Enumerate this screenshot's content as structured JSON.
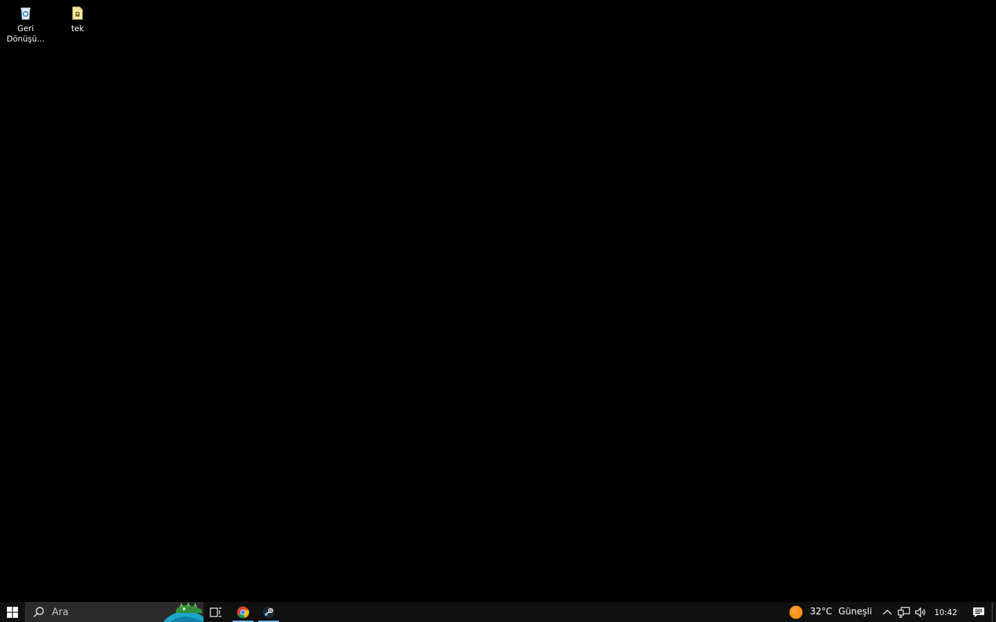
{
  "desktop": {
    "icons": [
      {
        "label": "Geri Dönüşü...",
        "icon": "recycle-bin-icon"
      },
      {
        "label": "tek",
        "icon": "file-icon"
      }
    ]
  },
  "taskbar": {
    "start_icon": "windows-logo-icon",
    "search": {
      "placeholder": "Ara",
      "value": ""
    },
    "task_view_icon": "task-view-icon",
    "apps": [
      {
        "icon": "chrome-icon",
        "active": true
      },
      {
        "icon": "steam-icon",
        "active": true
      }
    ],
    "weather": {
      "temperature": "32°C",
      "condition": "Güneşli",
      "icon": "sun-icon"
    },
    "tray": {
      "icons": [
        "chevron-up-icon",
        "network-icon",
        "volume-icon"
      ],
      "time": "10:42"
    },
    "notification_icon": "action-center-icon"
  },
  "colors": {
    "desktop_bg": "#000000",
    "taskbar_bg": "#101010",
    "search_bg": "#2b2b2b",
    "active_indicator": "#76b9ed",
    "sun": "#f7941d"
  }
}
